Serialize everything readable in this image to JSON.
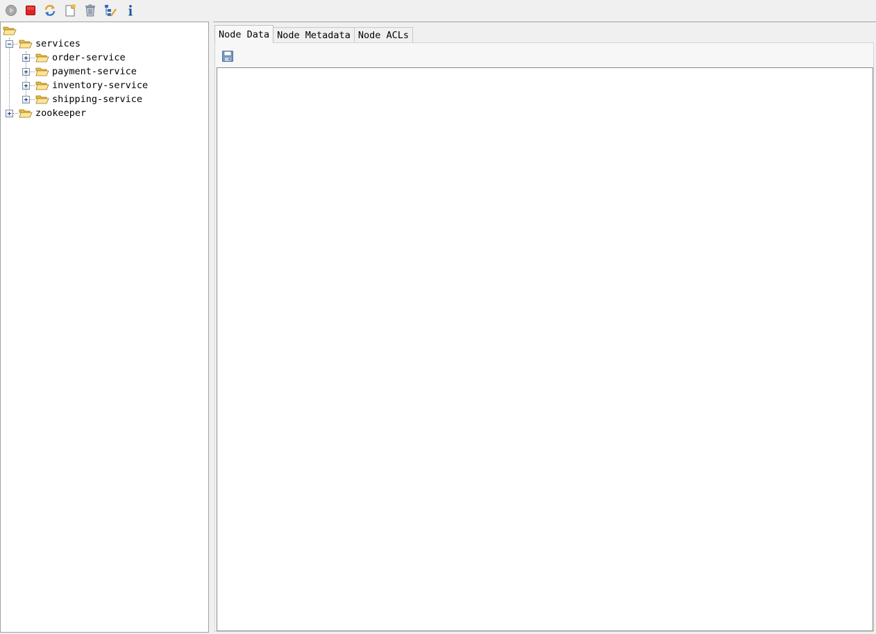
{
  "toolbar": {
    "buttons": [
      {
        "name": "connect",
        "icon": "connect-icon",
        "color": "#9a9a9a"
      },
      {
        "name": "disconnect",
        "icon": "stop-icon",
        "color": "#e02020"
      },
      {
        "name": "refresh",
        "icon": "refresh-icon",
        "color": "#e0a020"
      },
      {
        "name": "add-node",
        "icon": "add-node-icon",
        "color": "#e0c040"
      },
      {
        "name": "delete-node",
        "icon": "trash-icon",
        "color": "#7a8aa0"
      },
      {
        "name": "settings",
        "icon": "edit-tree-icon",
        "color": "#3060b0"
      },
      {
        "name": "about",
        "icon": "info-icon",
        "color": "#1a4fa0"
      }
    ]
  },
  "tree": {
    "root": {
      "label": "",
      "icon": "open-folder-icon"
    },
    "nodes": [
      {
        "label": "services",
        "expanded": true,
        "level": 1
      },
      {
        "label": "order-service",
        "expanded": false,
        "level": 2
      },
      {
        "label": "payment-service",
        "expanded": false,
        "level": 2
      },
      {
        "label": "inventory-service",
        "expanded": false,
        "level": 2
      },
      {
        "label": "shipping-service",
        "expanded": false,
        "level": 2
      },
      {
        "label": "zookeeper",
        "expanded": false,
        "level": 1
      }
    ]
  },
  "tabs": [
    {
      "label": "Node Data",
      "active": true
    },
    {
      "label": "Node Metadata",
      "active": false
    },
    {
      "label": "Node ACLs",
      "active": false
    }
  ],
  "node_data": {
    "save_icon": "save-icon",
    "content": ""
  }
}
